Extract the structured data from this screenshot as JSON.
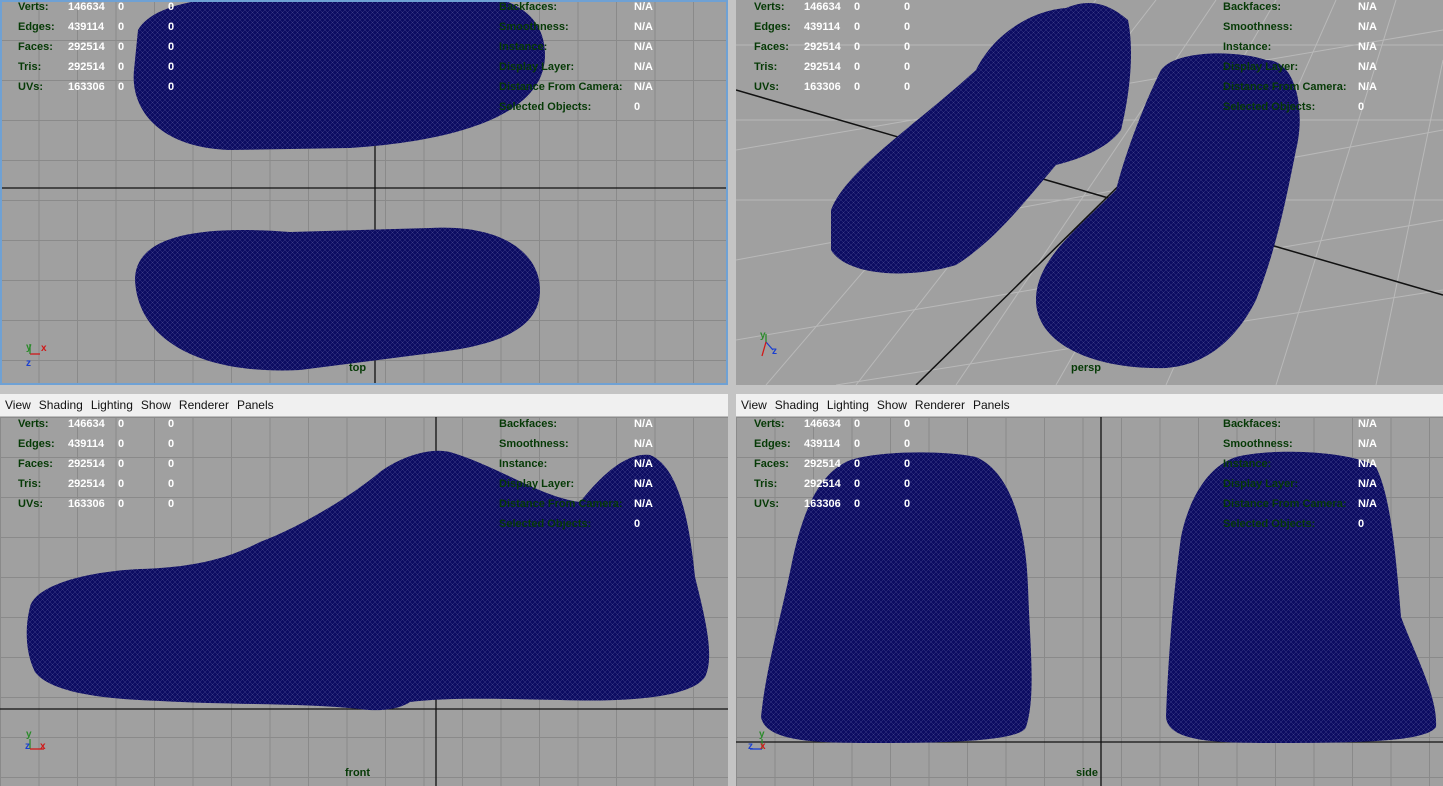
{
  "menu": [
    "View",
    "Shading",
    "Lighting",
    "Show",
    "Renderer",
    "Panels"
  ],
  "hud_left": [
    {
      "label": "Verts:",
      "total": "146634",
      "a": "0",
      "b": "0"
    },
    {
      "label": "Edges:",
      "total": "439114",
      "a": "0",
      "b": "0"
    },
    {
      "label": "Faces:",
      "total": "292514",
      "a": "0",
      "b": "0"
    },
    {
      "label": "Tris:",
      "total": "292514",
      "a": "0",
      "b": "0"
    },
    {
      "label": "UVs:",
      "total": "163306",
      "a": "0",
      "b": "0"
    }
  ],
  "hud_right": [
    {
      "label": "Backfaces:",
      "value": "N/A"
    },
    {
      "label": "Smoothness:",
      "value": "N/A"
    },
    {
      "label": "Instance:",
      "value": "N/A"
    },
    {
      "label": "Display Layer:",
      "value": "N/A"
    },
    {
      "label": "Distance From Camera:",
      "value": "N/A"
    },
    {
      "label": "Selected Objects:",
      "value": "0"
    }
  ],
  "panels": {
    "top": {
      "camera": "top"
    },
    "persp": {
      "camera": "persp"
    },
    "front": {
      "camera": "front"
    },
    "side": {
      "camera": "side"
    }
  },
  "axes": {
    "x": "x",
    "y": "y",
    "z": "z"
  },
  "colors": {
    "viewport_bg": "#a0a0a0",
    "grid": "#8a8a8a",
    "wireframe": "#0d0d62",
    "hud_label": "#063a06",
    "hud_value": "#ffffff",
    "active_border": "#6fa1d4"
  },
  "icons": {
    "axis_gizmo": "xyz-axis-icon"
  }
}
